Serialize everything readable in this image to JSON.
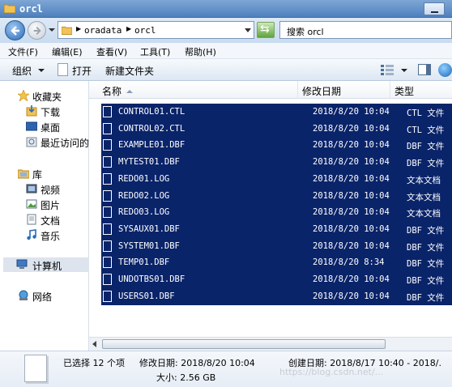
{
  "window": {
    "title": "orcl"
  },
  "address": {
    "crumbs": [
      "oradata",
      "orcl"
    ],
    "search_placeholder": "搜索 orcl"
  },
  "menu": [
    "文件(F)",
    "编辑(E)",
    "查看(V)",
    "工具(T)",
    "帮助(H)"
  ],
  "toolbar": {
    "organize": "组织",
    "open": "打开",
    "new_folder": "新建文件夹"
  },
  "nav": {
    "favorites": "收藏夹",
    "downloads": "下载",
    "desktop": "桌面",
    "recent": "最近访问的",
    "libraries": "库",
    "videos": "视频",
    "pictures": "图片",
    "documents": "文档",
    "music": "音乐",
    "computer": "计算机",
    "network": "网络"
  },
  "columns": {
    "name": "名称",
    "modified": "修改日期",
    "type": "类型"
  },
  "files": [
    {
      "name": "CONTROL01.CTL",
      "modified": "2018/8/20 10:04",
      "type": "CTL 文件"
    },
    {
      "name": "CONTROL02.CTL",
      "modified": "2018/8/20 10:04",
      "type": "CTL 文件"
    },
    {
      "name": "EXAMPLE01.DBF",
      "modified": "2018/8/20 10:04",
      "type": "DBF 文件"
    },
    {
      "name": "MYTEST01.DBF",
      "modified": "2018/8/20 10:04",
      "type": "DBF 文件"
    },
    {
      "name": "REDO01.LOG",
      "modified": "2018/8/20 10:04",
      "type": "文本文档"
    },
    {
      "name": "REDO02.LOG",
      "modified": "2018/8/20 10:04",
      "type": "文本文档"
    },
    {
      "name": "REDO03.LOG",
      "modified": "2018/8/20 10:04",
      "type": "文本文档"
    },
    {
      "name": "SYSAUX01.DBF",
      "modified": "2018/8/20 10:04",
      "type": "DBF 文件"
    },
    {
      "name": "SYSTEM01.DBF",
      "modified": "2018/8/20 10:04",
      "type": "DBF 文件"
    },
    {
      "name": "TEMP01.DBF",
      "modified": "2018/8/20 8:34",
      "type": "DBF 文件"
    },
    {
      "name": "UNDOTBS01.DBF",
      "modified": "2018/8/20 10:04",
      "type": "DBF 文件"
    },
    {
      "name": "USERS01.DBF",
      "modified": "2018/8/20 10:04",
      "type": "DBF 文件"
    }
  ],
  "details": {
    "selected": "已选择 12 个项",
    "modified": "修改日期: 2018/8/20 10:04",
    "created": "创建日期: 2018/8/17 10:40 - 2018/.",
    "size": "大小: 2.56 GB"
  },
  "watermark": "https://blog.csdn.net/...",
  "colors": {
    "selection": "#0a246a",
    "titlebar": "#4f80bd"
  }
}
